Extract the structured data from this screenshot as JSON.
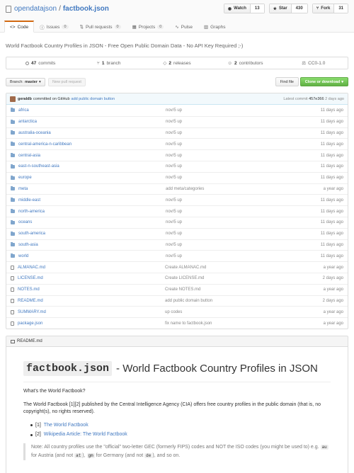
{
  "repo": {
    "owner": "opendatajson",
    "separator": "/",
    "name": "factbook.json"
  },
  "social": [
    {
      "label": "Watch",
      "count": "13"
    },
    {
      "label": "Star",
      "count": "430"
    },
    {
      "label": "Fork",
      "count": "31"
    }
  ],
  "tabs": [
    {
      "label": "Code",
      "counter": ""
    },
    {
      "label": "Issues",
      "counter": "0"
    },
    {
      "label": "Pull requests",
      "counter": "0"
    },
    {
      "label": "Projects",
      "counter": "0"
    },
    {
      "label": "Pulse",
      "counter": ""
    },
    {
      "label": "Graphs",
      "counter": ""
    }
  ],
  "description": "World Factbook Country Profiles in JSON - Free Open Public Domain Data - No API Key Required ;-)",
  "numbers": [
    {
      "value": "47",
      "label": "commits"
    },
    {
      "value": "1",
      "label": "branch"
    },
    {
      "value": "2",
      "label": "releases"
    },
    {
      "value": "2",
      "label": "contributors"
    },
    {
      "value": "",
      "label": "CC0-1.0"
    }
  ],
  "filenav": {
    "branch_label": "Branch:",
    "branch_name": "master",
    "new_pr": "New pull request",
    "find_file": "Find file",
    "clone": "Clone or download"
  },
  "commit": {
    "author": "geraldb",
    "via": "committed on GitHub",
    "message": "add public domain button",
    "latest_label": "Latest commit",
    "sha": "457e366",
    "age": "2 days ago"
  },
  "files": [
    {
      "type": "dir",
      "name": "africa",
      "message": "nov/5 up",
      "age": "11 days ago"
    },
    {
      "type": "dir",
      "name": "antarctica",
      "message": "nov/5 up",
      "age": "11 days ago"
    },
    {
      "type": "dir",
      "name": "australia-oceania",
      "message": "nov/5 up",
      "age": "11 days ago"
    },
    {
      "type": "dir",
      "name": "central-america-n-caribbean",
      "message": "nov/5 up",
      "age": "11 days ago"
    },
    {
      "type": "dir",
      "name": "central-asia",
      "message": "nov/5 up",
      "age": "11 days ago"
    },
    {
      "type": "dir",
      "name": "east-n-southeast-asia",
      "message": "nov/5 up",
      "age": "11 days ago"
    },
    {
      "type": "dir",
      "name": "europe",
      "message": "nov/5 up",
      "age": "11 days ago"
    },
    {
      "type": "dir",
      "name": "meta",
      "message": "add meta/categories",
      "age": "a year ago"
    },
    {
      "type": "dir",
      "name": "middle-east",
      "message": "nov/5 up",
      "age": "11 days ago"
    },
    {
      "type": "dir",
      "name": "north-america",
      "message": "nov/5 up",
      "age": "11 days ago"
    },
    {
      "type": "dir",
      "name": "oceans",
      "message": "nov/5 up",
      "age": "11 days ago"
    },
    {
      "type": "dir",
      "name": "south-america",
      "message": "nov/5 up",
      "age": "11 days ago"
    },
    {
      "type": "dir",
      "name": "south-asia",
      "message": "nov/5 up",
      "age": "11 days ago"
    },
    {
      "type": "dir",
      "name": "world",
      "message": "nov/5 up",
      "age": "11 days ago"
    },
    {
      "type": "file",
      "name": "ALMANAC.md",
      "message": "Create ALMANAC.md",
      "age": "a year ago"
    },
    {
      "type": "file",
      "name": "LICENSE.md",
      "message": "Create LICENSE.md",
      "age": "2 days ago"
    },
    {
      "type": "file",
      "name": "NOTES.md",
      "message": "Create NOTES.md",
      "age": "a year ago"
    },
    {
      "type": "file",
      "name": "README.md",
      "message": "add public domain button",
      "age": "2 days ago"
    },
    {
      "type": "file",
      "name": "SUMMARY.md",
      "message": "up codes",
      "age": "a year ago"
    },
    {
      "type": "file",
      "name": "package.json",
      "message": "fix name to factbook.json",
      "age": "a year ago"
    }
  ],
  "readme": {
    "header": "README.md",
    "title_code": "factbook.json",
    "title_rest": " - World Factbook Country Profiles in JSON",
    "question": "What's the World Factbook?",
    "intro_pre": "The World Factbook ",
    "intro_refs": "[1][2]",
    "intro_post": " published by the Central Intelligence Agency (CIA) offers free country profiles in the public domain (that is, no copyright(s), no rights reserved).",
    "links": [
      {
        "ref": "[1]",
        "text": "The World Factbook"
      },
      {
        "ref": "[2]",
        "text": "Wikipedia Article: The World Factbook"
      }
    ],
    "note_1": "Note: All country profiles use the \"official\" two-letter GEC (formerly FIPS) codes and NOT the ISO codes (you might be used to) e.g. ",
    "code_au": "au",
    "note_2": " for Austria (and not ",
    "code_at": "at",
    "note_3": "), ",
    "code_gm": "gm",
    "note_4": " for Germany (and not ",
    "code_de": "de",
    "note_5": "), and so on."
  }
}
